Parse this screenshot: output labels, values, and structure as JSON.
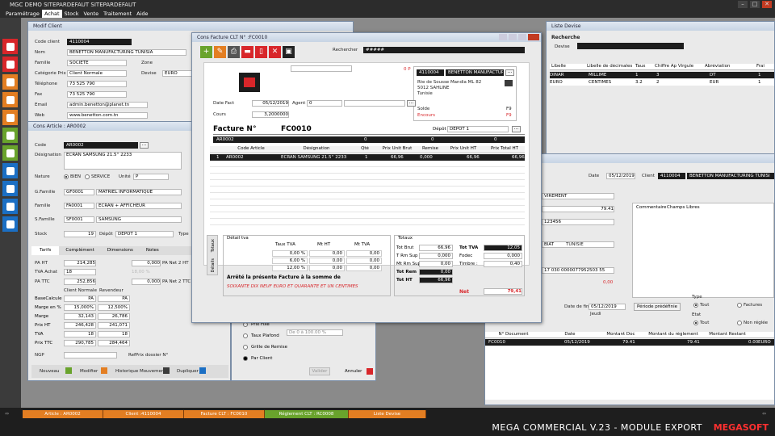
{
  "app": {
    "title": "MGC DEMO SITEPARDEFAUT SITEPARDEFAUT"
  },
  "menu": [
    "Paramétrage",
    "Achat",
    "Stock",
    "Vente",
    "Traitement",
    "Aide"
  ],
  "colors": {
    "accent_orange": "#e37e22",
    "green": "#69a32c",
    "red": "#d8262a",
    "dark": "#1c1c1c"
  },
  "client_window": {
    "title": "Modif Client",
    "labels": {
      "code": "Code client",
      "nom": "Nom",
      "famille": "Famille",
      "zone": "Zone",
      "categorie": "Catégorie Prix",
      "devise": "Devise",
      "telephone": "Téléphone",
      "fax": "Fax",
      "email": "Email",
      "web": "Web"
    },
    "code": "4110004",
    "nom": "BENETTON MANUFACTURING TUNISIA",
    "famille": "SOCIETE",
    "categorie": "Client Normale",
    "devise": "EURO",
    "telephone": "73 525 790",
    "fax": "73 525 790",
    "email": "admin.benetton@planet.tn",
    "web": "www.benetton.com.tn"
  },
  "article_window": {
    "title": "Cons Article : AR0002",
    "labels": {
      "code": "Code",
      "designation": "Désignation",
      "nature": "Nature",
      "bien": "BIEN",
      "service": "SERVICE",
      "unite": "Unité",
      "gfamille": "G.Famille",
      "famille": "Famille",
      "sfamille": "S.Famille",
      "stock": "Stock",
      "depot": "Dépôt",
      "type": "Type"
    },
    "code": "AR0002",
    "designation": "ECRAN SAMSUNG 21.5'' 2233",
    "unite": "P",
    "gfamille_code": "GF0001",
    "gfamille_name": "MATRIEL INFORMATIQUE",
    "famille_code": "FA0001",
    "famille_name": "ECRAN + AFFICHEUR",
    "sfamille_code": "SF0001",
    "sfamille_name": "SAMSUNG",
    "stock": "19",
    "depot": "DEPOT 1",
    "tabs": [
      "Tarifs",
      "Complément",
      "Dimensions",
      "Notes"
    ],
    "price_labels": {
      "pa_ht": "PA HT",
      "tva_achat": "TVA Achat",
      "pa_ttc": "PA TTC",
      "pa_net2_ht": "PA Net 2 HT",
      "pa_net2_ttc": "PA Net 2 TTC"
    },
    "pa_ht": "214,285",
    "tva_achat": "18",
    "pa_ttc": "252,856",
    "pa_net2_ht": "0,000",
    "pa_net2_ttc": "0,000",
    "pct": "18,00 %",
    "tier_headers": [
      "Client Normale",
      "Revendeur"
    ],
    "tier_rows": [
      {
        "label": "BaseCalcule",
        "a": "PA",
        "b": "PA"
      },
      {
        "label": "Marge en %",
        "a": "15,000%",
        "b": "12,500%"
      },
      {
        "label": "Marge",
        "a": "32,143",
        "b": "26,786"
      },
      {
        "label": "Prix HT",
        "a": "246,428",
        "b": "241,071"
      },
      {
        "label": "TVA",
        "a": "18",
        "b": "18"
      },
      {
        "label": "Prix TTC",
        "a": "290,785",
        "b": "284,464"
      }
    ],
    "ngp_label": "NGP",
    "refprix_label": "RefPrix dossier N°",
    "options": [
      "Prix Fixe",
      "Taux Plafond",
      "Grille de Remise",
      "Par Client"
    ],
    "plafond": "De 0 à 100.00 %",
    "buttons": {
      "nouveau": "Nouveau",
      "modifier": "Modifier",
      "historique": "Historique Mouvement",
      "dupliquer": "Dupliquer",
      "valider": "Valider",
      "annuler": "Annuler"
    }
  },
  "facture_window": {
    "title": "Cons Facture CLT N° :FC0010",
    "search_label": "Rechercher",
    "search_value": "#####",
    "op": "0 P",
    "date_label": "Date Fact",
    "date": "05/12/2019",
    "agent_label": "Agent",
    "agent": "0",
    "cours_label": "Cours",
    "cours": "3,2000000",
    "client_code": "4110004",
    "client_name": "BENETTON MANUFACTURING",
    "address1": "Rte de Sousse Mandia ML 82",
    "address2": "5012 SAHLINE",
    "address3": "Tunisie",
    "solde_label": "Solde",
    "solde": "F9",
    "encours_label": "Encours",
    "encours": "F9",
    "facture_label": "Facture N°",
    "facture_no": "FC0010",
    "depot_label": "Dépôt",
    "depot": "DEPOT 1",
    "line_code": "AR0002",
    "zeros": [
      "0",
      "0",
      "0"
    ],
    "columns": [
      "Code Article",
      "Désignation",
      "Qté",
      "Prix Unit Brut",
      "Remise",
      "Prix Unit HT",
      "Prix Total HT"
    ],
    "rows": [
      {
        "n": "1",
        "code": "AR0002",
        "designation": "ECRAN SAMSUNG 21.5'' 2233",
        "qte": "1",
        "brut": "66,96",
        "remise": "0,000",
        "unit_ht": "66,96",
        "total_ht": "66,96"
      }
    ],
    "side_tabs": [
      "Totaux",
      "Détails"
    ],
    "tva_title": "Détail tva",
    "tva_columns": [
      "Taux TVA",
      "Mt HT",
      "Mt TVA"
    ],
    "tva_rows": [
      {
        "taux": "0,00 %",
        "ht": "0,00",
        "tva": "0,00"
      },
      {
        "taux": "6,00 %",
        "ht": "0,00",
        "tva": "0,00"
      },
      {
        "taux": "12,00 %",
        "ht": "0,00",
        "tva": "0,00"
      }
    ],
    "arrete": "Arrêté la présente Facture à la somme de",
    "amount_words": "SOIXANTE DIX NEUF EURO ET QUARANTE ET UN CENTIMES",
    "totaux_title": "Totaux",
    "totals_left": [
      {
        "label": "Tot Brut",
        "value": "66,96"
      },
      {
        "label": "T Rm Sup",
        "value": "0,000"
      },
      {
        "label": "Mt Rm Sup",
        "value": "0,00"
      },
      {
        "label": "Tot Rem",
        "value": "0,00"
      },
      {
        "label": "Tot HT",
        "value": "66,96"
      }
    ],
    "totals_right": [
      {
        "label": "Tot TVA",
        "value": "12,05"
      },
      {
        "label": "Fodec",
        "value": "0,000"
      },
      {
        "label": "Timbre :",
        "value": "0,40"
      }
    ],
    "net_label": "Net",
    "net": "79,41"
  },
  "devise_window": {
    "title": "Liste Devise",
    "search_title": "Recherche",
    "devise_label": "Devise",
    "columns": [
      "Libelle",
      "Libelle de décimales",
      "Taux",
      "Chiffre Ap Virgule",
      "Abréviation",
      "Frai"
    ],
    "rows": [
      {
        "libelle": "DINAR",
        "dec": "MILLIME",
        "taux": "1",
        "chiffre": "3",
        "abrev": "DT"
      },
      {
        "libelle": "EURO",
        "dec": "CENTIMES",
        "taux": "3.2",
        "chiffre": "2",
        "abrev": "EUR"
      }
    ],
    "frai_values": [
      "1",
      "1"
    ]
  },
  "reglement_window": {
    "date_label": "Date",
    "date": "05/12/2019",
    "client_label": "Client",
    "client_code": "4110004",
    "client_name": "BENETTON MANUFACTURING TUNISI",
    "mode": "VIREMENT",
    "montant": "79.41",
    "ref": "123456",
    "banque": "BIAT",
    "pays": "TUNISIE",
    "rib": "17 030 0000077952503 55",
    "zero_amount": "0,00",
    "tabs": [
      "Commentaire",
      "Champs Libres"
    ],
    "date_fin_label": "Date de fin:",
    "date_fin": "05/12/2019",
    "periode_label": "Période prédéfinie",
    "jour": "Jeudi",
    "type_label": "Type",
    "type_opts": [
      "Tout",
      "Factures"
    ],
    "etat_label": "Etat",
    "etat_opts": [
      "Tout",
      "Non réglée"
    ],
    "columns": [
      "N° Document",
      "Date",
      "Montant Doc",
      "Montant du réglement",
      "Montant Restant"
    ],
    "rows": [
      {
        "doc": "FC0010",
        "date": "05/12/2019",
        "montant": "79.41",
        "regle": "79.41",
        "restant": "0.00",
        "devise": "EURO"
      }
    ]
  },
  "taskbar": {
    "tabs": [
      "Article : AR0002",
      "Client :4110004",
      "Facture CLT : FC0010",
      "Réglement CLT : RC0008",
      "Liste Devise"
    ],
    "brand": "MEGA COMMERCIAL V.23 - MODULE EXPORT",
    "logo": "MEGASOFT"
  }
}
